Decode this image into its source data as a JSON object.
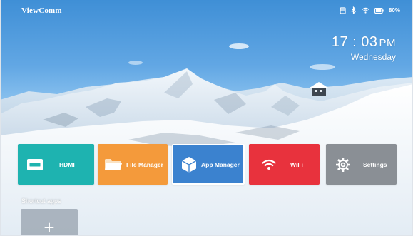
{
  "header": {
    "brand": "ViewComm",
    "battery_text": "80%",
    "status_icons": [
      "usb-drive-icon",
      "bluetooth-icon",
      "wifi-signal-icon",
      "battery-icon"
    ]
  },
  "clock": {
    "time": "17 : 03",
    "ampm": "PM",
    "day": "Wednesday"
  },
  "tiles": [
    {
      "label": "HDMI",
      "icon": "hdmi-icon",
      "color": "#1eb3b0"
    },
    {
      "label": "File Manager",
      "icon": "folder-icon",
      "color": "#f49a3b"
    },
    {
      "label": "App Manager",
      "icon": "cube-icon",
      "color": "#3b82cf",
      "selected": true
    },
    {
      "label": "WiFi",
      "icon": "wifi-icon",
      "color": "#e8323d"
    },
    {
      "label": "Settings",
      "icon": "gear-icon",
      "color": "#8a8f95"
    }
  ],
  "shortcuts": {
    "label": "Shortcut apps",
    "add_symbol": "+"
  }
}
